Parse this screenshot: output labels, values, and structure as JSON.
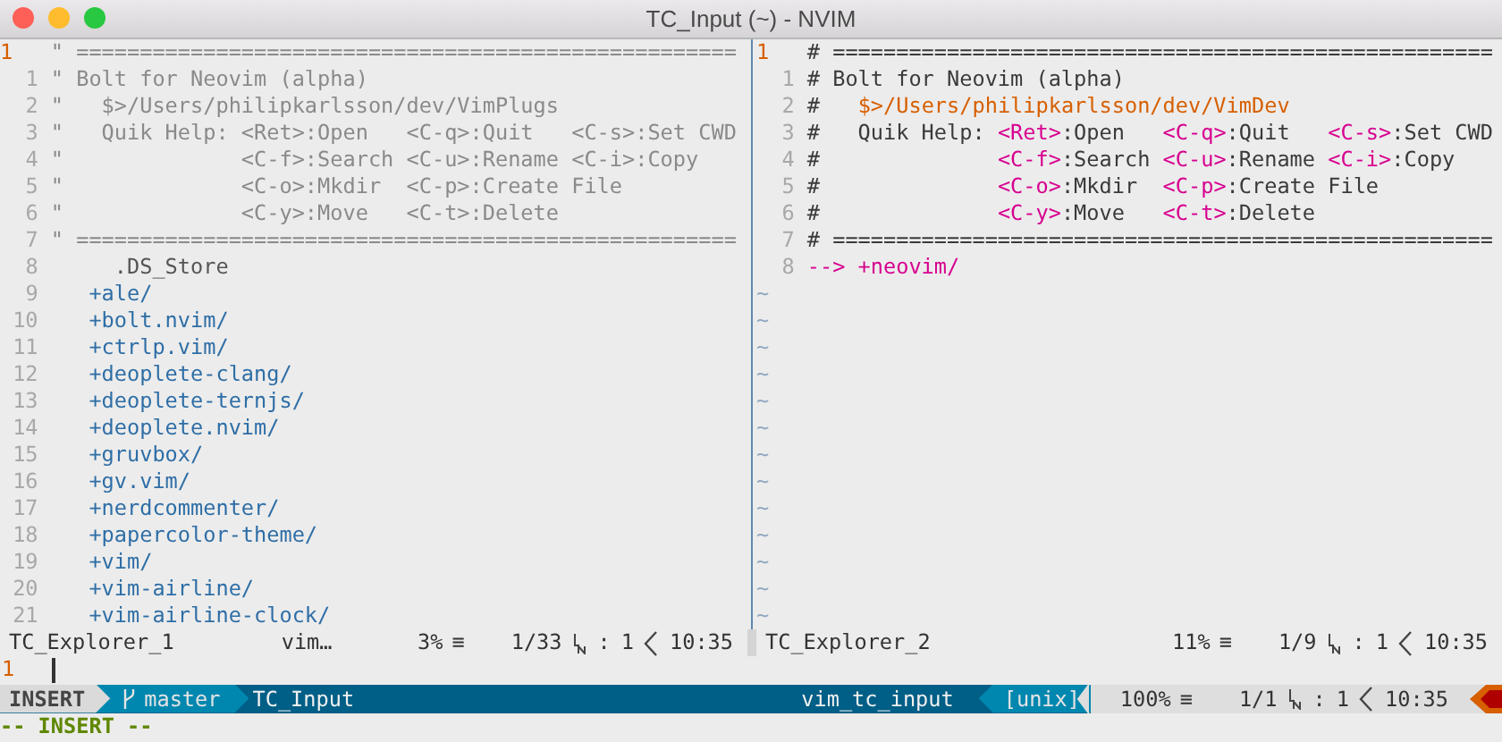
{
  "window": {
    "title": "TC_Input (~) - NVIM"
  },
  "panes": [
    {
      "lines": [
        {
          "number": "1",
          "current": true,
          "segments": [
            {
              "kind": "comment",
              "text": "\" ===================================================="
            }
          ]
        },
        {
          "number": "1",
          "current": false,
          "segments": [
            {
              "kind": "comment",
              "text": "\" Bolt for Neovim (alpha)"
            }
          ]
        },
        {
          "number": "2",
          "current": false,
          "segments": [
            {
              "kind": "comment",
              "text": "\"   $>/Users/philipkarlsson/dev/VimPlugs"
            }
          ]
        },
        {
          "number": "3",
          "current": false,
          "segments": [
            {
              "kind": "comment",
              "text": "\"   Quik Help: <Ret>:Open   <C-q>:Quit   <C-s>:Set CWD"
            }
          ]
        },
        {
          "number": "4",
          "current": false,
          "segments": [
            {
              "kind": "comment",
              "text": "\"              <C-f>:Search <C-u>:Rename <C-i>:Copy"
            }
          ]
        },
        {
          "number": "5",
          "current": false,
          "segments": [
            {
              "kind": "comment",
              "text": "\"              <C-o>:Mkdir  <C-p>:Create File"
            }
          ]
        },
        {
          "number": "6",
          "current": false,
          "segments": [
            {
              "kind": "comment",
              "text": "\"              <C-y>:Move   <C-t>:Delete"
            }
          ]
        },
        {
          "number": "7",
          "current": false,
          "segments": [
            {
              "kind": "comment",
              "text": "\" ===================================================="
            }
          ]
        },
        {
          "number": "8",
          "current": false,
          "segments": [
            {
              "kind": "file",
              "text": "     .DS_Store"
            }
          ]
        },
        {
          "number": "9",
          "current": false,
          "segments": [
            {
              "kind": "dir",
              "text": "   +ale/"
            }
          ]
        },
        {
          "number": "10",
          "current": false,
          "segments": [
            {
              "kind": "dir",
              "text": "   +bolt.nvim/"
            }
          ]
        },
        {
          "number": "11",
          "current": false,
          "segments": [
            {
              "kind": "dir",
              "text": "   +ctrlp.vim/"
            }
          ]
        },
        {
          "number": "12",
          "current": false,
          "segments": [
            {
              "kind": "dir",
              "text": "   +deoplete-clang/"
            }
          ]
        },
        {
          "number": "13",
          "current": false,
          "segments": [
            {
              "kind": "dir",
              "text": "   +deoplete-ternjs/"
            }
          ]
        },
        {
          "number": "14",
          "current": false,
          "segments": [
            {
              "kind": "dir",
              "text": "   +deoplete.nvim/"
            }
          ]
        },
        {
          "number": "15",
          "current": false,
          "segments": [
            {
              "kind": "dir",
              "text": "   +gruvbox/"
            }
          ]
        },
        {
          "number": "16",
          "current": false,
          "segments": [
            {
              "kind": "dir",
              "text": "   +gv.vim/"
            }
          ]
        },
        {
          "number": "17",
          "current": false,
          "segments": [
            {
              "kind": "dir",
              "text": "   +nerdcommenter/"
            }
          ]
        },
        {
          "number": "18",
          "current": false,
          "segments": [
            {
              "kind": "dir",
              "text": "   +papercolor-theme/"
            }
          ]
        },
        {
          "number": "19",
          "current": false,
          "segments": [
            {
              "kind": "dir",
              "text": "   +vim/"
            }
          ]
        },
        {
          "number": "20",
          "current": false,
          "segments": [
            {
              "kind": "dir",
              "text": "   +vim-airline/"
            }
          ]
        },
        {
          "number": "21",
          "current": false,
          "segments": [
            {
              "kind": "dir",
              "text": "   +vim-airline-clock/"
            }
          ]
        }
      ],
      "status": {
        "name": "TC_Explorer_1",
        "filetype": "vim…",
        "percent": "3%",
        "menu_glyph": "≡",
        "position": "1/33",
        "separator": ":",
        "column": "1",
        "time": "10:35"
      }
    },
    {
      "lines": [
        {
          "number": "1",
          "current": true,
          "segments": [
            {
              "kind": "text",
              "text": "# ===================================================="
            }
          ]
        },
        {
          "number": "1",
          "current": false,
          "segments": [
            {
              "kind": "text",
              "text": "# Bolt for Neovim (alpha)"
            }
          ]
        },
        {
          "number": "2",
          "current": false,
          "segments": [
            {
              "kind": "text",
              "text": "#   "
            },
            {
              "kind": "path",
              "text": "$>/Users/philipkarlsson/dev/VimDev"
            }
          ]
        },
        {
          "number": "3",
          "current": false,
          "segments": [
            {
              "kind": "text",
              "text": "#   Quik Help: "
            },
            {
              "kind": "key",
              "text": "<Ret>"
            },
            {
              "kind": "text",
              "text": ":Open   "
            },
            {
              "kind": "key",
              "text": "<C-q>"
            },
            {
              "kind": "text",
              "text": ":Quit   "
            },
            {
              "kind": "key",
              "text": "<C-s>"
            },
            {
              "kind": "text",
              "text": ":Set CWD"
            }
          ]
        },
        {
          "number": "4",
          "current": false,
          "segments": [
            {
              "kind": "text",
              "text": "#              "
            },
            {
              "kind": "key",
              "text": "<C-f>"
            },
            {
              "kind": "text",
              "text": ":Search "
            },
            {
              "kind": "key",
              "text": "<C-u>"
            },
            {
              "kind": "text",
              "text": ":Rename "
            },
            {
              "kind": "key",
              "text": "<C-i>"
            },
            {
              "kind": "text",
              "text": ":Copy"
            }
          ]
        },
        {
          "number": "5",
          "current": false,
          "segments": [
            {
              "kind": "text",
              "text": "#              "
            },
            {
              "kind": "key",
              "text": "<C-o>"
            },
            {
              "kind": "text",
              "text": ":Mkdir  "
            },
            {
              "kind": "key",
              "text": "<C-p>"
            },
            {
              "kind": "text",
              "text": ":Create File"
            }
          ]
        },
        {
          "number": "6",
          "current": false,
          "segments": [
            {
              "kind": "text",
              "text": "#              "
            },
            {
              "kind": "key",
              "text": "<C-y>"
            },
            {
              "kind": "text",
              "text": ":Move   "
            },
            {
              "kind": "key",
              "text": "<C-t>"
            },
            {
              "kind": "text",
              "text": ":Delete"
            }
          ]
        },
        {
          "number": "7",
          "current": false,
          "segments": [
            {
              "kind": "text",
              "text": "# ===================================================="
            }
          ]
        },
        {
          "number": "8",
          "current": false,
          "segments": [
            {
              "kind": "arrow",
              "text": "--> +neovim/"
            }
          ]
        },
        {
          "segments": [
            {
              "kind": "tilde",
              "text": "~"
            }
          ]
        },
        {
          "segments": [
            {
              "kind": "tilde",
              "text": "~"
            }
          ]
        },
        {
          "segments": [
            {
              "kind": "tilde",
              "text": "~"
            }
          ]
        },
        {
          "segments": [
            {
              "kind": "tilde",
              "text": "~"
            }
          ]
        },
        {
          "segments": [
            {
              "kind": "tilde",
              "text": "~"
            }
          ]
        },
        {
          "segments": [
            {
              "kind": "tilde",
              "text": "~"
            }
          ]
        },
        {
          "segments": [
            {
              "kind": "tilde",
              "text": "~"
            }
          ]
        },
        {
          "segments": [
            {
              "kind": "tilde",
              "text": "~"
            }
          ]
        },
        {
          "segments": [
            {
              "kind": "tilde",
              "text": "~"
            }
          ]
        },
        {
          "segments": [
            {
              "kind": "tilde",
              "text": "~"
            }
          ]
        },
        {
          "segments": [
            {
              "kind": "tilde",
              "text": "~"
            }
          ]
        },
        {
          "segments": [
            {
              "kind": "tilde",
              "text": "~"
            }
          ]
        },
        {
          "segments": [
            {
              "kind": "tilde",
              "text": "~"
            }
          ]
        }
      ],
      "status": {
        "name": "TC_Explorer_2",
        "percent": "11%",
        "menu_glyph": "≡",
        "position": "1/9",
        "separator": ":",
        "column": "1",
        "time": "10:35"
      }
    }
  ],
  "command_line": {
    "number": "1"
  },
  "airline": {
    "mode": "INSERT",
    "branch": "master",
    "file": "TC_Input",
    "filetype": "vim_tc_input",
    "format": "[unix]",
    "percent": "100%",
    "menu_glyph": "≡",
    "position": "1/1",
    "separator": ":",
    "column": "1",
    "time": "10:35"
  },
  "message": "-- INSERT --"
}
